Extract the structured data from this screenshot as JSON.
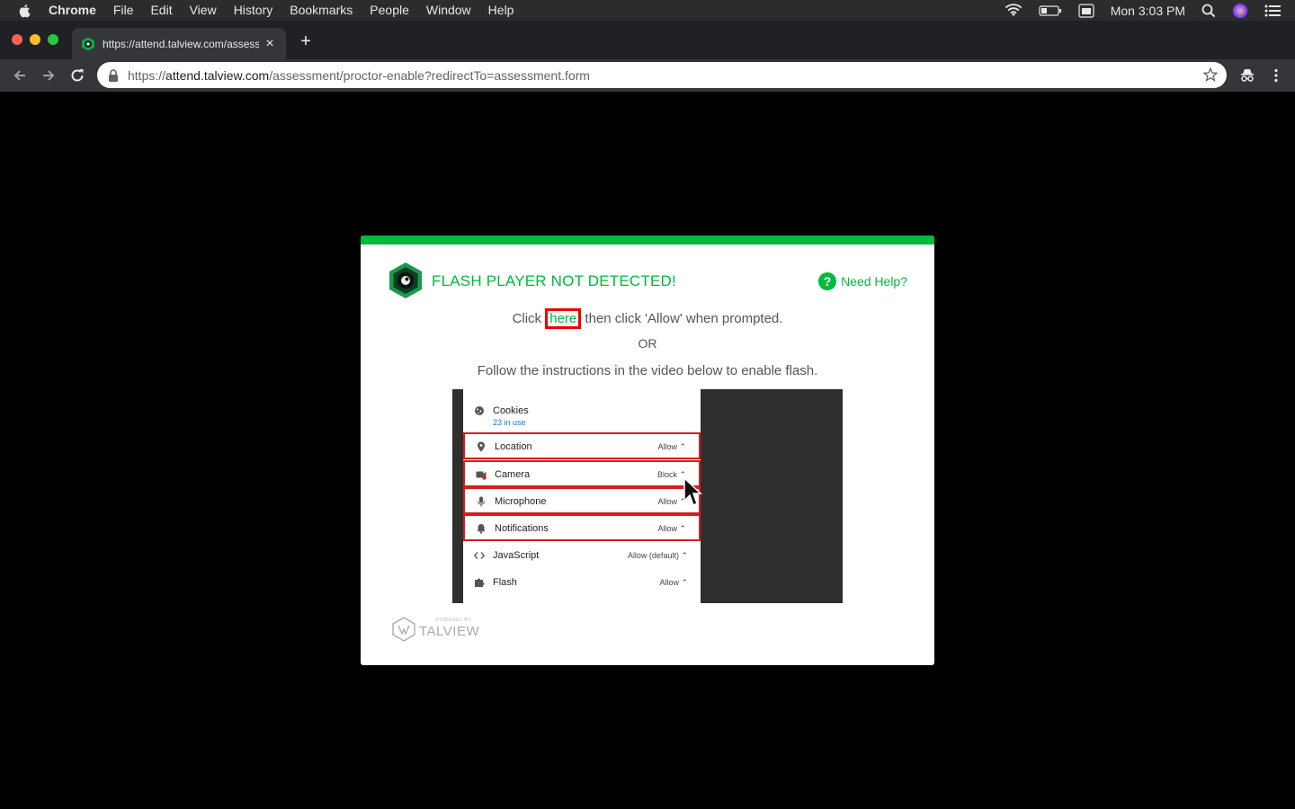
{
  "menubar": {
    "app": "Chrome",
    "items": [
      "File",
      "Edit",
      "View",
      "History",
      "Bookmarks",
      "People",
      "Window",
      "Help"
    ],
    "clock": "Mon 3:03 PM"
  },
  "tab": {
    "title": "https://attend.talview.com/assessment/proctor-enable?redirectTo=assessment.form"
  },
  "omnibox": {
    "scheme": "https://",
    "host": "attend.talview.com",
    "path": "/assessment/proctor-enable?redirectTo=assessment.form"
  },
  "modal": {
    "title": "FLASH PLAYER NOT DETECTED!",
    "help_icon": "?",
    "help_label": "Need Help?",
    "line1_before": "Click ",
    "line1_link": "here",
    "line1_after": " then click 'Allow' when prompted.",
    "or": "OR",
    "line2": "Follow the instructions in the video below to enable flash.",
    "powered_small": "POWERED BY",
    "powered_brand": "TALVIEW"
  },
  "video": {
    "cookies": {
      "label": "Cookies",
      "sub": "23 in use"
    },
    "permissions": [
      {
        "label": "Location",
        "value": "Allow ⌃",
        "icon": "location-pin-icon",
        "boxed": true
      },
      {
        "label": "Camera",
        "value": "Block ⌃",
        "icon": "camera-icon",
        "boxed": true
      },
      {
        "label": "Microphone",
        "value": "Allow ⌃",
        "icon": "microphone-icon",
        "boxed": true
      },
      {
        "label": "Notifications",
        "value": "Allow ⌃",
        "icon": "bell-icon",
        "boxed": true
      },
      {
        "label": "JavaScript",
        "value": "Allow (default) ⌃",
        "icon": "code-icon",
        "boxed": false
      },
      {
        "label": "Flash",
        "value": "Allow ⌃",
        "icon": "puzzle-icon",
        "boxed": false
      }
    ]
  },
  "colors": {
    "accent": "#00b93f",
    "highlight": "#e00000",
    "background": "#000000"
  }
}
